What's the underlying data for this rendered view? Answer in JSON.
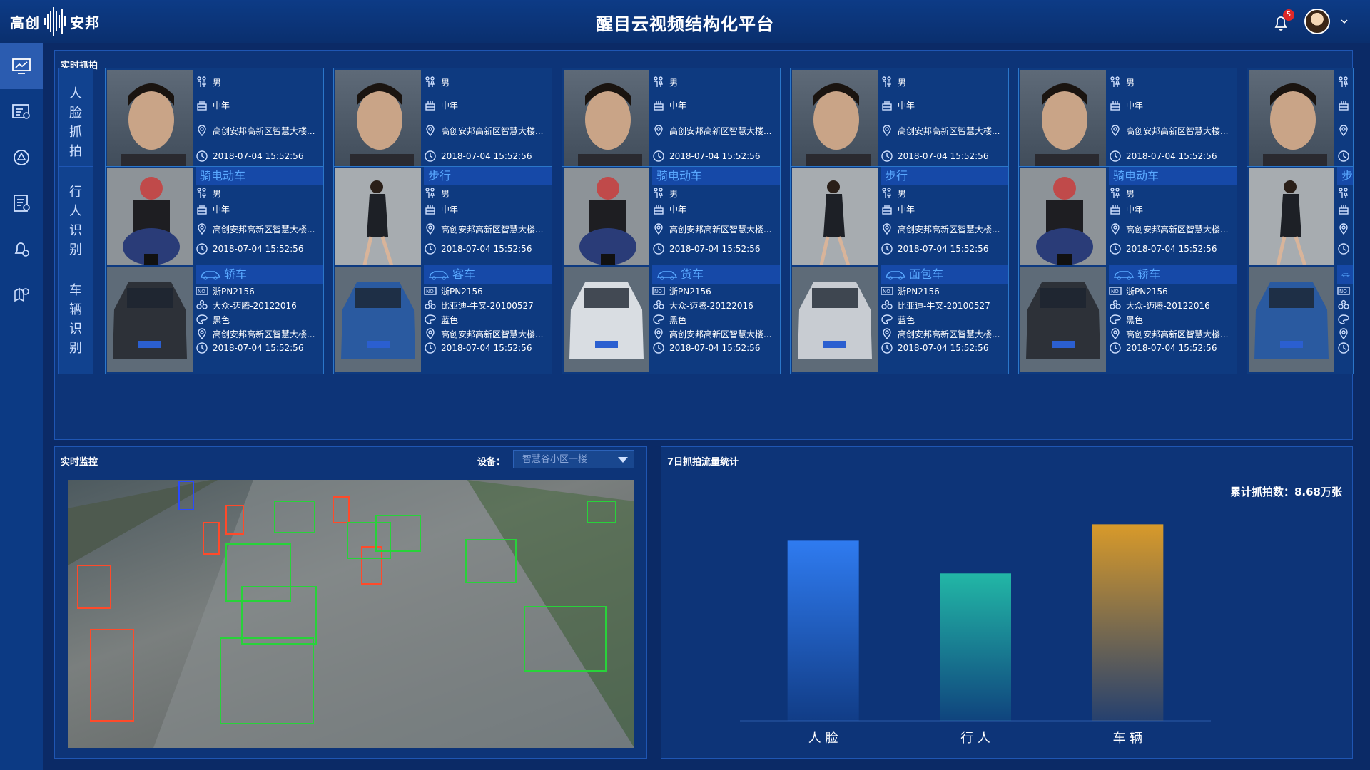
{
  "header": {
    "logo_left": "高创",
    "logo_right": "安邦",
    "title": "醒目云视频结构化平台",
    "notification_count": "5"
  },
  "sidebar": {
    "items": [
      {
        "icon": "monitor-chart-icon",
        "active": true
      },
      {
        "icon": "list-settings-icon",
        "active": false
      },
      {
        "icon": "target-icon",
        "active": false
      },
      {
        "icon": "report-icon",
        "active": false
      },
      {
        "icon": "alarm-bell-icon",
        "active": false
      },
      {
        "icon": "map-pin-icon",
        "active": false
      }
    ]
  },
  "capture": {
    "title": "实时抓拍",
    "rows": [
      {
        "label": [
          "人",
          "脸",
          "抓",
          "拍"
        ]
      },
      {
        "label": [
          "行",
          "人",
          "识",
          "别"
        ]
      },
      {
        "label": [
          "车",
          "辆",
          "识",
          "别"
        ]
      }
    ],
    "faces": [
      {
        "gender": "男",
        "age": "中年",
        "location": "高创安邦高新区智慧大楼...",
        "time": "2018-07-04  15:52:56"
      },
      {
        "gender": "男",
        "age": "中年",
        "location": "高创安邦高新区智慧大楼...",
        "time": "2018-07-04  15:52:56"
      },
      {
        "gender": "男",
        "age": "中年",
        "location": "高创安邦高新区智慧大楼...",
        "time": "2018-07-04  15:52:56"
      },
      {
        "gender": "男",
        "age": "中年",
        "location": "高创安邦高新区智慧大楼...",
        "time": "2018-07-04  15:52:56"
      },
      {
        "gender": "男",
        "age": "中年",
        "location": "高创安邦高新区智慧大楼...",
        "time": "2018-07-04  15:52:56"
      },
      {
        "gender": "",
        "age": "",
        "location": "",
        "time": ""
      }
    ],
    "pedestrians": [
      {
        "type": "骑电动车",
        "gender": "男",
        "age": "中年",
        "location": "高创安邦高新区智慧大楼...",
        "time": "2018-07-04  15:52:56",
        "kind": "moto"
      },
      {
        "type": "步行",
        "gender": "男",
        "age": "中年",
        "location": "高创安邦高新区智慧大楼...",
        "time": "2018-07-04  15:52:56",
        "kind": "walk"
      },
      {
        "type": "骑电动车",
        "gender": "男",
        "age": "中年",
        "location": "高创安邦高新区智慧大楼...",
        "time": "2018-07-04  15:52:56",
        "kind": "moto"
      },
      {
        "type": "步行",
        "gender": "男",
        "age": "中年",
        "location": "高创安邦高新区智慧大楼...",
        "time": "2018-07-04  15:52:56",
        "kind": "walk"
      },
      {
        "type": "骑电动车",
        "gender": "男",
        "age": "中年",
        "location": "高创安邦高新区智慧大楼...",
        "time": "2018-07-04  15:52:56",
        "kind": "moto"
      },
      {
        "type": "步",
        "gender": "",
        "age": "",
        "location": "",
        "time": "",
        "kind": "walk"
      }
    ],
    "vehicles": [
      {
        "type": "轿车",
        "plate": "浙PN2156",
        "model": "大众-迈腾-20122016",
        "color": "黑色",
        "location": "高创安邦高新区智慧大楼...",
        "time": "2018-07-04  15:52:56",
        "photo": "#2d3138"
      },
      {
        "type": "客车",
        "plate": "浙PN2156",
        "model": "比亚迪-牛叉-20100527",
        "color": "蓝色",
        "location": "高创安邦高新区智慧大楼...",
        "time": "2018-07-04  15:52:56",
        "photo": "#2a5aa0"
      },
      {
        "type": "货车",
        "plate": "浙PN2156",
        "model": "大众-迈腾-20122016",
        "color": "黑色",
        "location": "高创安邦高新区智慧大楼...",
        "time": "2018-07-04  15:52:56",
        "photo": "#d9dde2"
      },
      {
        "type": "面包车",
        "plate": "浙PN2156",
        "model": "比亚迪-牛叉-20100527",
        "color": "蓝色",
        "location": "高创安邦高新区智慧大楼...",
        "time": "2018-07-04  15:52:56",
        "photo": "#c8ccd2"
      },
      {
        "type": "轿车",
        "plate": "浙PN2156",
        "model": "大众-迈腾-20122016",
        "color": "黑色",
        "location": "高创安邦高新区智慧大楼...",
        "time": "2018-07-04  15:52:56",
        "photo": "#2d3138"
      },
      {
        "type": "",
        "plate": "",
        "model": "",
        "color": "",
        "location": "",
        "time": "",
        "photo": "#2a5aa0"
      }
    ]
  },
  "monitor": {
    "title": "实时监控",
    "device_label": "设备：",
    "device_value": "智慧谷小区一楼"
  },
  "stats": {
    "title": "7日抓拍流量统计",
    "total": "累计抓拍数：8.68万张"
  },
  "chart_data": {
    "type": "bar",
    "categories": [
      "人 脸",
      "行 人",
      "车 辆"
    ],
    "values": [
      2.75,
      2.25,
      3.0
    ],
    "colors": [
      "#2f7bf0",
      "#22b7a6",
      "#d89a2a"
    ],
    "ylim": [
      0,
      3.2
    ],
    "title": "",
    "xlabel": "",
    "ylabel": ""
  }
}
